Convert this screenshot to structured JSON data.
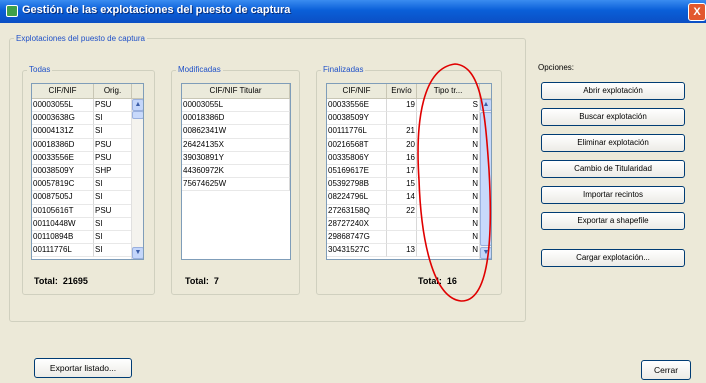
{
  "window": {
    "title": "Gestión de las explotaciones del puesto de captura",
    "close": "X"
  },
  "group_main": {
    "legend": "Explotaciones del puesto de captura"
  },
  "todas": {
    "legend": "Todas",
    "columns": [
      "CIF/NIF",
      "Orig."
    ],
    "rows": [
      [
        "00003055L",
        "PSU"
      ],
      [
        "00003638G",
        "SI"
      ],
      [
        "00004131Z",
        "SI"
      ],
      [
        "00018386D",
        "PSU"
      ],
      [
        "00033556E",
        "PSU"
      ],
      [
        "00038509Y",
        "SHP"
      ],
      [
        "00057819C",
        "SI"
      ],
      [
        "00087505J",
        "SI"
      ],
      [
        "00105616T",
        "PSU"
      ],
      [
        "00110448W",
        "SI"
      ],
      [
        "00110894B",
        "SI"
      ],
      [
        "00111776L",
        "SI"
      ]
    ],
    "total_label": "Total:",
    "total_value": "21695"
  },
  "modificadas": {
    "legend": "Modificadas",
    "columns": [
      "CIF/NIF Titular"
    ],
    "rows": [
      [
        "00003055L"
      ],
      [
        "00018386D"
      ],
      [
        "00862341W"
      ],
      [
        "26424135X"
      ],
      [
        "39030891Y"
      ],
      [
        "44360972K"
      ],
      [
        "75674625W"
      ]
    ],
    "total_label": "Total:",
    "total_value": "7"
  },
  "finalizadas": {
    "legend": "Finalizadas",
    "columns": [
      "CIF/NIF",
      "Envío",
      "Tipo tr..."
    ],
    "rows": [
      [
        "00033556E",
        "19",
        "S"
      ],
      [
        "00038509Y",
        "",
        "N"
      ],
      [
        "00111776L",
        "21",
        "N"
      ],
      [
        "00216568T",
        "20",
        "N"
      ],
      [
        "00335806Y",
        "16",
        "N"
      ],
      [
        "05169617E",
        "17",
        "N"
      ],
      [
        "05392798B",
        "15",
        "N"
      ],
      [
        "08224796L",
        "14",
        "N"
      ],
      [
        "27263158Q",
        "22",
        "N"
      ],
      [
        "28727240X",
        "",
        "N"
      ],
      [
        "29868747G",
        "",
        "N"
      ],
      [
        "30431527C",
        "13",
        "N"
      ]
    ],
    "total_label": "Total:",
    "total_value": "16"
  },
  "options": {
    "label": "Opciones:",
    "buttons": [
      "Abrir explotación",
      "Buscar explotación",
      "Eliminar explotación",
      "Cambio de Titularidad",
      "Importar recintos",
      "Exportar a shapefile",
      "Cargar explotación..."
    ]
  },
  "footer": {
    "export_list": "Exportar listado...",
    "close": "Cerrar"
  },
  "colors": {
    "titlebar": "#0b4fc4",
    "annotation": "#e00000",
    "legend_text": "#1f50c8"
  }
}
